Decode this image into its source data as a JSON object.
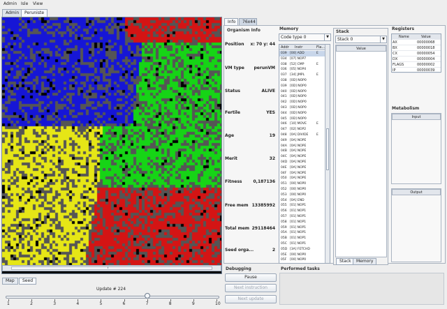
{
  "menu": {
    "items": [
      "Admin",
      "Isle",
      "View"
    ]
  },
  "left_tabs": [
    {
      "label": "Admin",
      "active": false
    },
    {
      "label": "Peruniste",
      "active": true
    }
  ],
  "world_colors": {
    "blue": "#1616d6",
    "green": "#16d416",
    "red": "#d41414",
    "yellow": "#e6e616",
    "gray": "#555555",
    "black": "#000000"
  },
  "bottom": {
    "tabs": [
      {
        "label": "Map",
        "active": false
      },
      {
        "label": "Seed",
        "active": true
      }
    ],
    "update_label": "Update # 224",
    "slider_value": 7,
    "slider_ticks": [
      "1",
      "2",
      "3",
      "4",
      "5",
      "6",
      "7",
      "8",
      "9",
      "10"
    ]
  },
  "right_tabs": [
    {
      "label": "Info",
      "active": true
    },
    {
      "label": "76x44",
      "active": false
    }
  ],
  "organism": {
    "title": "Organism Info",
    "fields": [
      {
        "label": "Position",
        "value": "x: 70 y: 44"
      },
      {
        "label": "VM type",
        "value": "perunVM"
      },
      {
        "label": "Status",
        "value": "ALIVE"
      },
      {
        "label": "Fertile",
        "value": "YES"
      },
      {
        "label": "Age",
        "value": "19"
      },
      {
        "label": "Merit",
        "value": "32"
      },
      {
        "label": "Fitness",
        "value": "0,187136"
      },
      {
        "label": "Free mem",
        "value": "13385992"
      },
      {
        "label": "Total mem",
        "value": "29118464"
      },
      {
        "label": "Seed orga...",
        "value": "2"
      }
    ]
  },
  "memory": {
    "title": "Memory",
    "select": "Code type 0",
    "headers": [
      "Addr",
      "Instr",
      "Fla..."
    ],
    "rows": [
      [
        "039",
        "[00] ADD",
        "E"
      ],
      [
        "034",
        "[07] NOP7",
        ""
      ],
      [
        "038",
        "[52] CMP",
        "E"
      ],
      [
        "036",
        "[05] NOP4",
        ""
      ],
      [
        "037",
        "[34] JMPL",
        "E"
      ],
      [
        "038",
        "[0D] NOP0",
        ""
      ],
      [
        "039",
        "[0D] NOP0",
        ""
      ],
      [
        "040",
        "[0D] NOP0",
        ""
      ],
      [
        "041",
        "[0D] NOP0",
        ""
      ],
      [
        "042",
        "[0D] NOP0",
        ""
      ],
      [
        "043",
        "[0D] NOP0",
        ""
      ],
      [
        "044",
        "[0D] NOP0",
        ""
      ],
      [
        "045",
        "[0D] NOP0",
        ""
      ],
      [
        "046",
        "[10] MOVE",
        "E"
      ],
      [
        "047",
        "[02] NOP2",
        ""
      ],
      [
        "048",
        "[0A] DIVIDE",
        "E"
      ],
      [
        "049",
        "[0A] NOPE",
        ""
      ],
      [
        "04A",
        "[0A] NOPE",
        ""
      ],
      [
        "04B",
        "[0A] NOPE",
        ""
      ],
      [
        "04C",
        "[0A] NOPE",
        ""
      ],
      [
        "04D",
        "[0A] NOPE",
        ""
      ],
      [
        "04E",
        "[0A] NOPE",
        ""
      ],
      [
        "04F",
        "[0A] NOPE",
        ""
      ],
      [
        "050",
        "[0A] NOPE",
        ""
      ],
      [
        "051",
        "[00] NOP0",
        ""
      ],
      [
        "052",
        "[00] NOP0",
        ""
      ],
      [
        "053",
        "[00] NOP0",
        ""
      ],
      [
        "054",
        "[0A] END",
        ""
      ],
      [
        "055",
        "[01] NOP1",
        ""
      ],
      [
        "056",
        "[01] NOP1",
        ""
      ],
      [
        "057",
        "[01] NOP1",
        ""
      ],
      [
        "058",
        "[01] NOP1",
        ""
      ],
      [
        "059",
        "[01] NOP1",
        ""
      ],
      [
        "05A",
        "[01] NOP1",
        ""
      ],
      [
        "05B",
        "[01] NOP1",
        ""
      ],
      [
        "05C",
        "[01] NOP1",
        ""
      ],
      [
        "05D",
        "[3A] FETCHD",
        ""
      ],
      [
        "05E",
        "[00] NOP0",
        ""
      ],
      [
        "05F",
        "[00] NOP0",
        ""
      ]
    ]
  },
  "stack": {
    "title": "Stack",
    "select": "Stack 0",
    "header": "Value",
    "bottom_tabs": [
      {
        "label": "Stack",
        "active": true
      },
      {
        "label": "Memory",
        "active": false
      }
    ]
  },
  "registers": {
    "title": "Registers",
    "headers": [
      "Name",
      "Value"
    ],
    "rows": [
      [
        "AX",
        "00000068"
      ],
      [
        "BX",
        "00000018"
      ],
      [
        "CX",
        "00000054"
      ],
      [
        "DX",
        "00000004"
      ],
      [
        "FLAGS",
        "00000002"
      ],
      [
        "IP",
        "00000039"
      ]
    ]
  },
  "metabolism": {
    "title": "Metabolism",
    "input_label": "Input",
    "output_label": "Output"
  },
  "debugging": {
    "title": "Debugging",
    "buttons": [
      {
        "label": "Pause",
        "enabled": true
      },
      {
        "label": "Next instruction",
        "enabled": false
      },
      {
        "label": "Next update",
        "enabled": false
      }
    ]
  },
  "performed_tasks": {
    "title": "Performed tasks"
  }
}
